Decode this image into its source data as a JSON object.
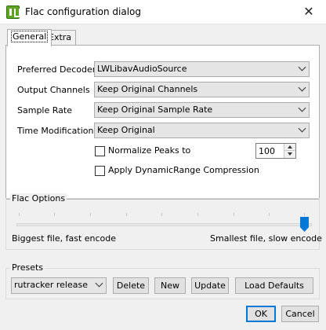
{
  "window": {
    "title": "Flac configuration dialog",
    "close_glyph": "✕"
  },
  "tabs": [
    {
      "label": "General"
    },
    {
      "label": "Extra"
    }
  ],
  "general": {
    "preferred_decoder": {
      "label": "Preferred Decoder",
      "value": "LWLibavAudioSource"
    },
    "output_channels": {
      "label": "Output Channels",
      "value": "Keep Original Channels"
    },
    "sample_rate": {
      "label": "Sample Rate",
      "value": "Keep Original Sample Rate"
    },
    "time_modification": {
      "label": "Time Modification",
      "value": "Keep Original"
    },
    "normalize": {
      "label": "Normalize Peaks to",
      "checked": false,
      "value": "100"
    },
    "drc": {
      "label": "Apply DynamicRange Compression",
      "checked": false
    }
  },
  "flac_options": {
    "title": "Flac Options",
    "left_label": "Biggest file, fast encode",
    "right_label": "Smallest file, slow encode",
    "slider_level": 8,
    "slider_max": 8
  },
  "presets": {
    "title": "Presets",
    "selected": "rutracker release",
    "buttons": {
      "delete": "Delete",
      "new": "New",
      "update": "Update",
      "load_defaults": "Load Defaults"
    }
  },
  "dialog_buttons": {
    "ok": "OK",
    "cancel": "Cancel"
  },
  "colors": {
    "accent": "#0078d7",
    "app_icon": "#5fa422"
  }
}
